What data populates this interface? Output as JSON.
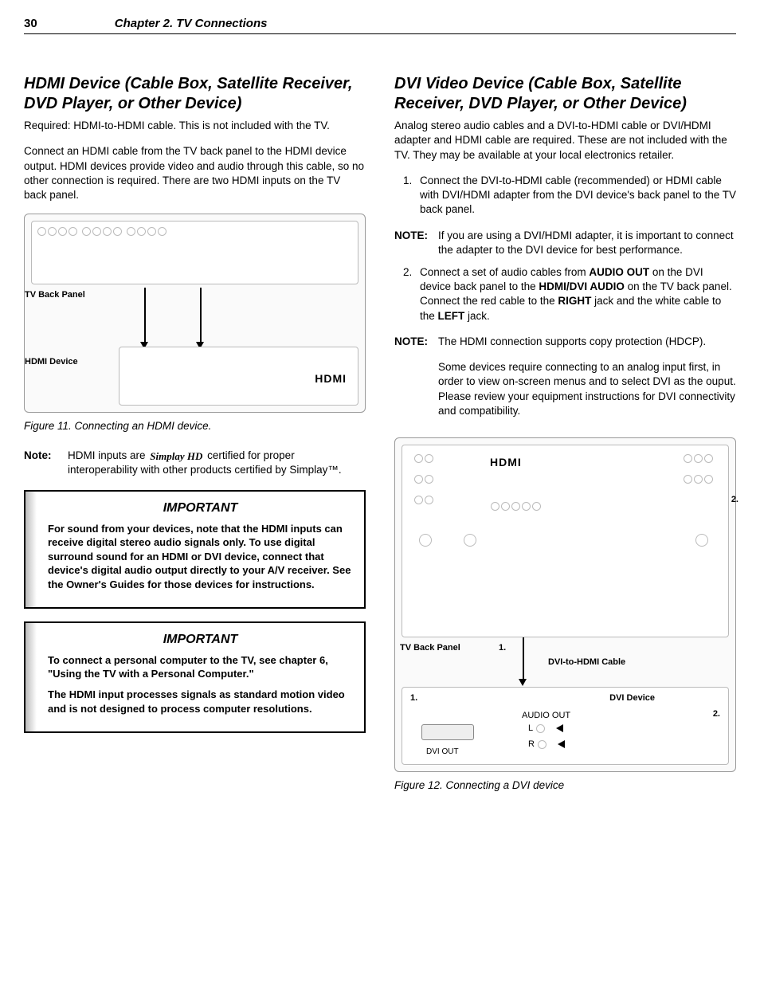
{
  "header": {
    "page_number": "30",
    "chapter": "Chapter 2. TV Connections"
  },
  "left": {
    "heading": "HDMI Device (Cable Box, Satellite Receiver, DVD Player, or Other Device)",
    "p1": "Required:  HDMI-to-HDMI cable.  This is not included with the TV.",
    "p2": "Connect an HDMI cable from the TV back panel to the HDMI device output.  HDMI devices provide video and audio through this cable, so no other connection is required.  There are two HDMI inputs on the TV back panel.",
    "fig11_labels": {
      "tv_back_panel": "TV Back Panel",
      "hdmi_device": "HDMI Device",
      "hdmi_logo": "HDMI"
    },
    "fig11_caption": "Figure 11.  Connecting an HDMI device.",
    "note_label": "Note:",
    "note_pre": "HDMI inputs are ",
    "note_brand": "Simplay HD",
    "note_post": " certified for proper interoperability with other products certified by Simplay™.",
    "important1_title": "IMPORTANT",
    "important1_body": "For sound from your devices, note that the HDMI inputs can receive digital stereo audio signals only.  To use digital surround sound for an HDMI or DVI device, connect that device's digital audio output directly to your A/V receiver.  See the Owner's Guides for those devices for instructions.",
    "important2_title": "IMPORTANT",
    "important2_p1": "To connect a personal computer to the TV, see chapter 6, \"Using the TV with a Personal Computer.\"",
    "important2_p2": "The HDMI input processes signals as standard motion video and is not designed to process computer resolutions."
  },
  "right": {
    "heading": "DVI Video Device (Cable Box, Satellite Receiver, DVD Player, or Other Device)",
    "p1": "Analog stereo audio cables and a DVI-to-HDMI cable or DVI/HDMI adapter and HDMI cable are required.  These are not included with the TV.  They may be available at your local electronics retailer.",
    "li1": "Connect the DVI-to-HDMI cable (recommended) or HDMI cable with DVI/HDMI adapter from the DVI device's back panel to the TV back panel.",
    "note1_label": "NOTE:",
    "note1_body": "If you are using a DVI/HDMI adapter, it is important to connect the adapter to the DVI device for best performance.",
    "li2_pre": "Connect a set of audio cables from ",
    "li2_b1": "AUDIO OUT",
    "li2_mid1": " on the DVI device back panel to the ",
    "li2_b2": "HDMI/DVI AUDIO",
    "li2_mid2": " on the TV back panel.  Connect the red cable to the ",
    "li2_b3": "RIGHT",
    "li2_mid3": " jack and the white cable to the ",
    "li2_b4": "LEFT",
    "li2_end": " jack.",
    "note2_label": "NOTE:",
    "note2_p1": "The HDMI connection supports copy protection (HDCP).",
    "note2_p2": "Some devices require connecting to an analog input first, in order to view on-screen menus and to select DVI as the ouput.  Please review your equipment instructions for DVI connectivity and compatibility.",
    "fig12_labels": {
      "tv_back_panel": "TV Back Panel",
      "dvi_device": "DVI Device",
      "dvi_cable": "DVI-to-HDMI Cable",
      "audio_out": "AUDIO OUT",
      "L": "L",
      "R": "R",
      "dvi_out": "DVI OUT",
      "n1": "1.",
      "n2": "2.",
      "hdmi_logo": "HDMI"
    },
    "fig12_caption": "Figure 12.  Connecting a DVI device"
  }
}
